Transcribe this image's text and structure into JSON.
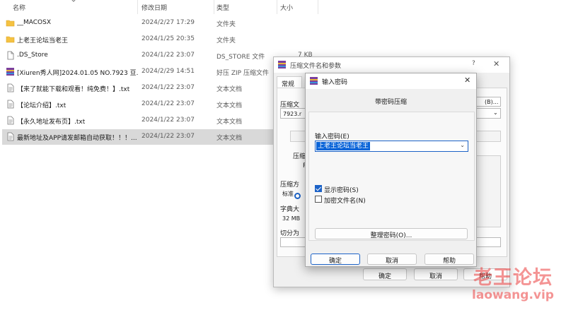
{
  "columns": {
    "name": "名称",
    "date": "修改日期",
    "type": "类型",
    "size": "大小"
  },
  "files": [
    {
      "name": "__MACOSX",
      "date": "2024/2/27 17:29",
      "type": "文件夹",
      "size": "",
      "icon": "folder-icon"
    },
    {
      "name": "上老王论坛当老王",
      "date": "2024/1/25 20:35",
      "type": "文件夹",
      "size": "",
      "icon": "folder-icon"
    },
    {
      "name": ".DS_Store",
      "date": "2024/1/22 23:07",
      "type": "DS_STORE 文件",
      "size": "7 KB",
      "icon": "file-icon"
    },
    {
      "name": "[Xiuren秀人网]2024.01.05 NO.7923 豆...",
      "date": "2024/2/29 14:51",
      "type": "好压 ZIP 压缩文件",
      "size": "",
      "icon": "archive-icon"
    },
    {
      "name": "【来了就能下载和观看！纯免费！】.txt",
      "date": "2024/1/22 23:07",
      "type": "文本文档",
      "size": "",
      "icon": "text-file-icon"
    },
    {
      "name": "【论坛介绍】.txt",
      "date": "2024/1/22 23:07",
      "type": "文本文档",
      "size": "",
      "icon": "text-file-icon"
    },
    {
      "name": "【永久地址发布页】.txt",
      "date": "2024/1/22 23:07",
      "type": "文本文档",
      "size": "",
      "icon": "text-file-icon"
    },
    {
      "name": "最新地址及APP请发邮箱自动获取！！！...",
      "date": "2024/1/22 23:07",
      "type": "文本文档",
      "size": "",
      "icon": "text-file-icon",
      "selected": true
    }
  ],
  "archive_dialog": {
    "title": "压缩文件名和参数",
    "help": "?",
    "close": "✕",
    "tab_general": "常规",
    "archive_name_label": "压缩文",
    "archive_name_value": "7923.r",
    "browse_label": "(B)...",
    "format_label": "压缩文",
    "format_option": "RA",
    "method_label": "压缩方",
    "method_value": "标准",
    "dict_label": "字典大",
    "dict_value": "32 MB",
    "split_label": "切分为",
    "ok": "确定",
    "cancel": "取消",
    "help_btn": "帮助"
  },
  "password_dialog": {
    "title": "输入密码",
    "close": "✕",
    "heading": "带密码压缩",
    "password_label": "输入密码(E)",
    "password_value": "上老王论坛当老王",
    "show_password": "显示密码(S)",
    "show_password_checked": true,
    "encrypt_names": "加密文件名(N)",
    "encrypt_names_checked": false,
    "organize": "整理密码(O)...",
    "ok": "确定",
    "cancel": "取消",
    "help": "帮助"
  },
  "watermark": {
    "line1": "老王论坛",
    "line2": "laowang.vip"
  },
  "colors": {
    "accent": "#1d63c7",
    "selection": "#0a64d8",
    "folder": "#f5c242",
    "watermark": "#eb3c3c"
  }
}
